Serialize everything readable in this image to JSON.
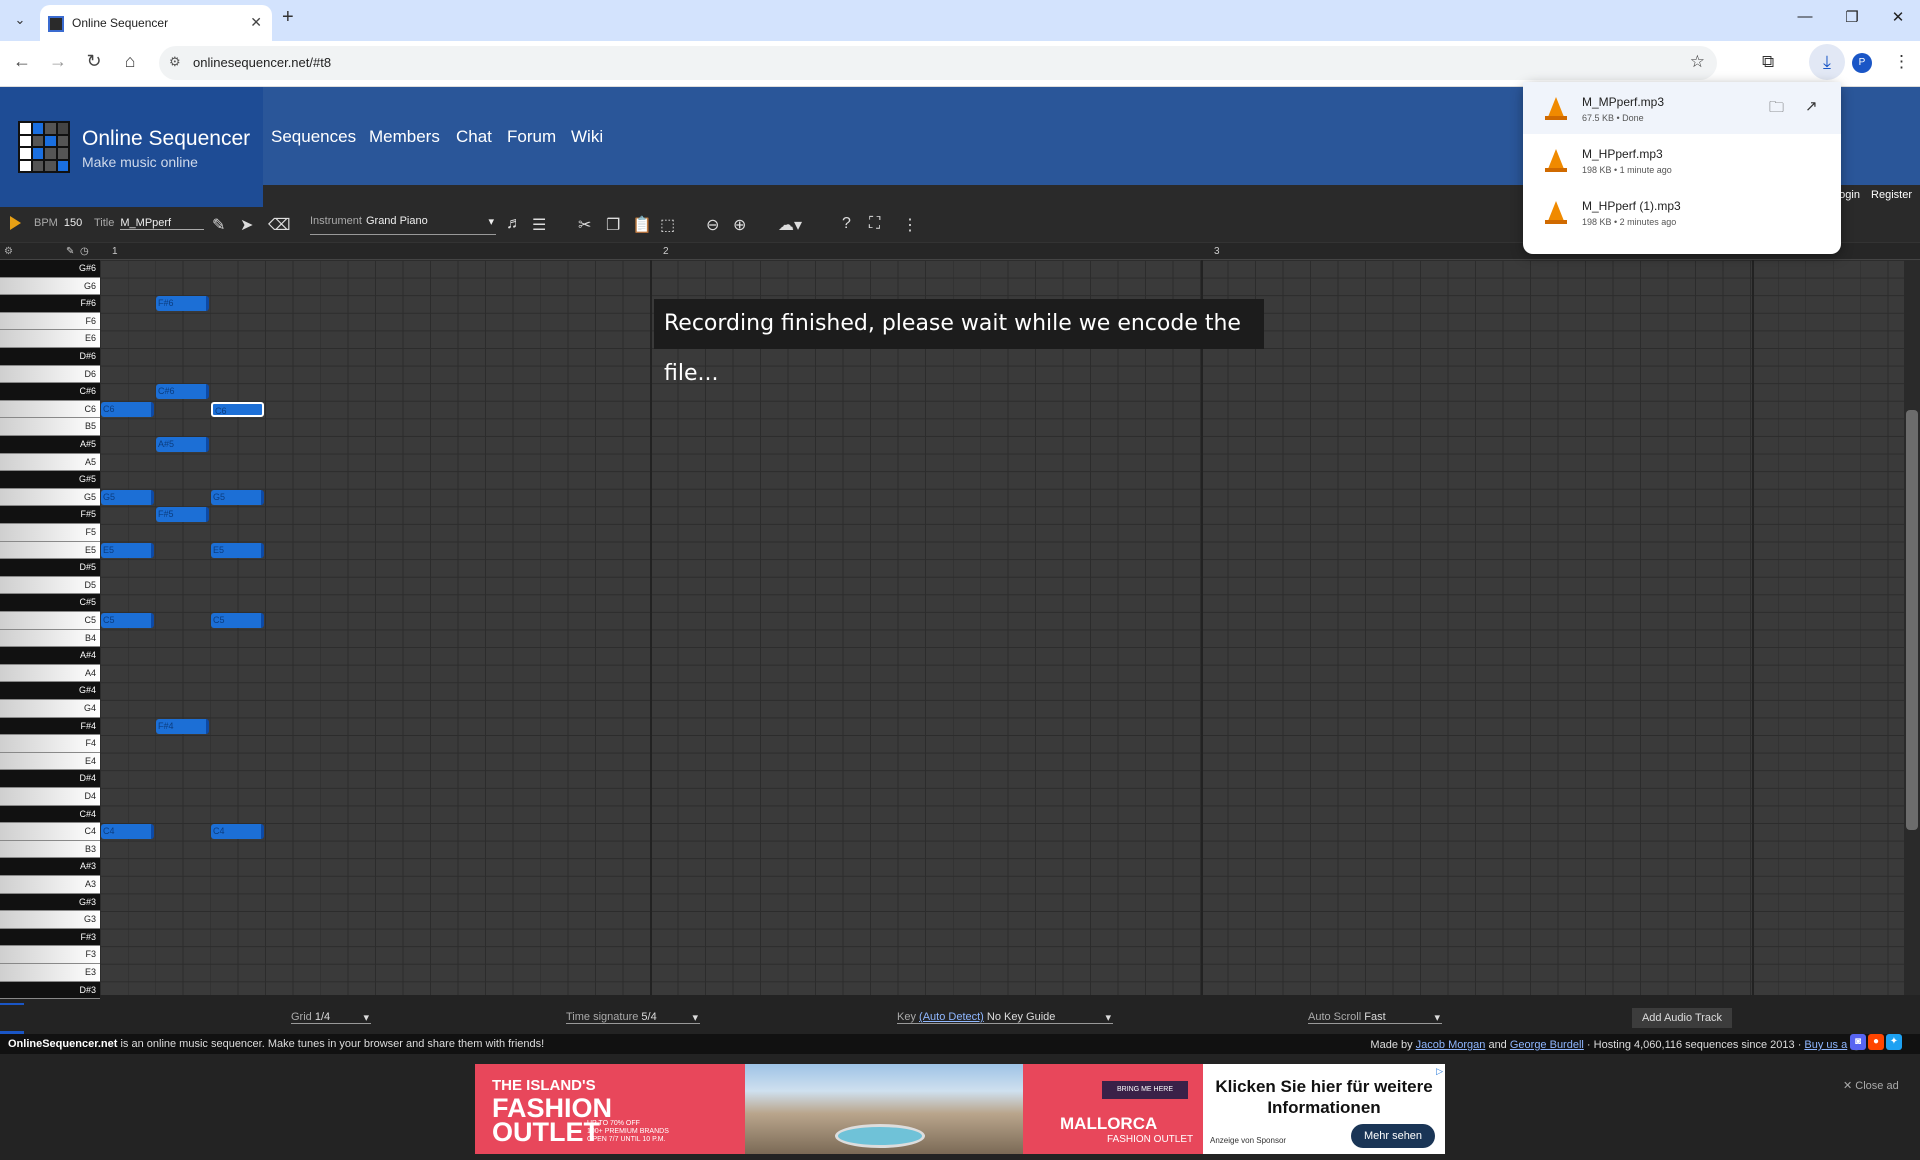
{
  "browser": {
    "tab_title": "Online Sequencer",
    "url": "onlinesequencer.net/#t8",
    "avatar_letter": "P"
  },
  "downloads": [
    {
      "name": "M_MPperf.mp3",
      "meta": "67.5 KB • Done"
    },
    {
      "name": "M_HPperf.mp3",
      "meta": "198 KB • 1 minute ago"
    },
    {
      "name": "M_HPperf (1).mp3",
      "meta": "198 KB • 2 minutes ago"
    }
  ],
  "site": {
    "title": "Online Sequencer",
    "subtitle": "Make music online",
    "nav": [
      "Sequences",
      "Members",
      "Chat",
      "Forum",
      "Wiki"
    ],
    "login": "Login",
    "register": "Register"
  },
  "editor": {
    "bpm_label": "BPM",
    "bpm": "150",
    "title_label": "Title",
    "title": "M_MPperf",
    "instrument_label": "Instrument",
    "instrument": "Grand Piano"
  },
  "ruler": [
    "1",
    "2",
    "3"
  ],
  "keys": [
    {
      "n": "G#6",
      "b": true
    },
    {
      "n": "G6",
      "b": false
    },
    {
      "n": "F#6",
      "b": true
    },
    {
      "n": "F6",
      "b": false
    },
    {
      "n": "E6",
      "b": false
    },
    {
      "n": "D#6",
      "b": true
    },
    {
      "n": "D6",
      "b": false
    },
    {
      "n": "C#6",
      "b": true
    },
    {
      "n": "C6",
      "b": false
    },
    {
      "n": "B5",
      "b": false
    },
    {
      "n": "A#5",
      "b": true
    },
    {
      "n": "A5",
      "b": false
    },
    {
      "n": "G#5",
      "b": true
    },
    {
      "n": "G5",
      "b": false
    },
    {
      "n": "F#5",
      "b": true
    },
    {
      "n": "F5",
      "b": false
    },
    {
      "n": "E5",
      "b": false
    },
    {
      "n": "D#5",
      "b": true
    },
    {
      "n": "D5",
      "b": false
    },
    {
      "n": "C#5",
      "b": true
    },
    {
      "n": "C5",
      "b": false
    },
    {
      "n": "B4",
      "b": false
    },
    {
      "n": "A#4",
      "b": true
    },
    {
      "n": "A4",
      "b": false
    },
    {
      "n": "G#4",
      "b": true
    },
    {
      "n": "G4",
      "b": false
    },
    {
      "n": "F#4",
      "b": true
    },
    {
      "n": "F4",
      "b": false
    },
    {
      "n": "E4",
      "b": false
    },
    {
      "n": "D#4",
      "b": true
    },
    {
      "n": "D4",
      "b": false
    },
    {
      "n": "C#4",
      "b": true
    },
    {
      "n": "C4",
      "b": false
    },
    {
      "n": "B3",
      "b": false
    },
    {
      "n": "A#3",
      "b": true
    },
    {
      "n": "A3",
      "b": false
    },
    {
      "n": "G#3",
      "b": true
    },
    {
      "n": "G3",
      "b": false
    },
    {
      "n": "F#3",
      "b": true
    },
    {
      "n": "F3",
      "b": false
    },
    {
      "n": "E3",
      "b": false
    },
    {
      "n": "D#3",
      "b": true
    }
  ],
  "notes": [
    {
      "pitch": "C6",
      "start": 0,
      "len": 1,
      "selected": false
    },
    {
      "pitch": "G5",
      "start": 0,
      "len": 1,
      "selected": false
    },
    {
      "pitch": "E5",
      "start": 0,
      "len": 1,
      "selected": false
    },
    {
      "pitch": "C5",
      "start": 0,
      "len": 1,
      "selected": false
    },
    {
      "pitch": "C4",
      "start": 0,
      "len": 1,
      "selected": false
    },
    {
      "pitch": "F#6",
      "start": 2,
      "len": 1,
      "selected": false
    },
    {
      "pitch": "C#6",
      "start": 2,
      "len": 1,
      "selected": false
    },
    {
      "pitch": "A#5",
      "start": 2,
      "len": 1,
      "selected": false
    },
    {
      "pitch": "F#5",
      "start": 2,
      "len": 1,
      "selected": false
    },
    {
      "pitch": "F#4",
      "start": 2,
      "len": 1,
      "selected": false
    },
    {
      "pitch": "C6",
      "start": 4,
      "len": 1,
      "selected": true
    },
    {
      "pitch": "G5",
      "start": 4,
      "len": 1,
      "selected": false
    },
    {
      "pitch": "E5",
      "start": 4,
      "len": 1,
      "selected": false
    },
    {
      "pitch": "C5",
      "start": 4,
      "len": 1,
      "selected": false
    },
    {
      "pitch": "C4",
      "start": 4,
      "len": 1,
      "selected": false
    }
  ],
  "toast": "Recording finished, please wait while we encode the file...",
  "bottom": {
    "grid_label": "Grid",
    "grid": "1/4",
    "timesig_label": "Time signature",
    "timesig": "5/4",
    "key_label": "Key",
    "key_link": "(Auto Detect)",
    "key": "No Key Guide",
    "autoscroll_label": "Auto Scroll",
    "autoscroll": "Fast",
    "add_audio": "Add Audio Track"
  },
  "footer": {
    "brand": "OnlineSequencer.net",
    "desc": " is an online music sequencer. Make tunes in your browser and share them with friends!",
    "made_by": "Made by ",
    "author1": "Jacob Morgan",
    "and": " and ",
    "author2": "George Burdell",
    "hosting": " · Hosting 4,060,116 sequences since 2013 · ",
    "buy": "Buy us a"
  },
  "ad": {
    "line1": "THE ISLAND'S",
    "line2": "FASHION",
    "line3": "OUTLET",
    "small": "UP TO 70% OFF\n100+ PREMIUM BRANDS\nOPEN 7/7 UNTIL 10 P.M.",
    "bring": "BRING ME HERE",
    "brand": "MALLORCA",
    "brand_sub": "FASHION OUTLET",
    "cta_text": "Klicken Sie hier für weitere Informationen",
    "sponsor": "Anzeige von Sponsor",
    "button": "Mehr sehen",
    "close": "✕ Close ad"
  },
  "colors": {
    "note": "#1c6fd6",
    "header": "#2a5699",
    "accent": "#1a56c6"
  }
}
